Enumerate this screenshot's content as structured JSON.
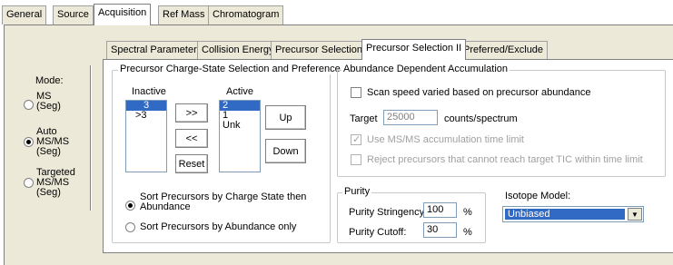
{
  "top_tabs": [
    {
      "label": "General"
    },
    {
      "label": "Source"
    },
    {
      "label": "Acquisition"
    },
    {
      "label": "Ref Mass"
    },
    {
      "label": "Chromatogram"
    }
  ],
  "mode": {
    "label": "Mode:",
    "options": [
      {
        "label": "MS\n(Seg)",
        "checked": false
      },
      {
        "label": "Auto\nMS/MS\n(Seg)",
        "checked": true
      },
      {
        "label": "Targeted\nMS/MS\n(Seg)",
        "checked": false
      }
    ]
  },
  "sub_tabs": [
    {
      "label": "Spectral Parameters"
    },
    {
      "label": "Collision Energy"
    },
    {
      "label": "Precursor Selection I"
    },
    {
      "label": "Precursor Selection II"
    },
    {
      "label": "Preferred/Exclude"
    }
  ],
  "charge_state": {
    "title": "Precursor Charge-State Selection and Preference",
    "inactive_label": "Inactive",
    "active_label": "Active",
    "inactive_items": [
      "3",
      ">3"
    ],
    "active_items": [
      "2",
      "1",
      "Unk"
    ],
    "add_label": ">>",
    "remove_label": "<<",
    "reset_label": "Reset",
    "up_label": "Up",
    "down_label": "Down",
    "sort_by_charge_label": "Sort Precursors by Charge State then\nAbundance",
    "sort_by_abundance_label": "Sort Precursors by Abundance only"
  },
  "abundance": {
    "title": "Abundance Dependent Accumulation",
    "scan_speed_label": "Scan speed varied based on precursor abundance",
    "target_label": "Target",
    "target_value": "25000",
    "target_unit": "counts/spectrum",
    "use_limit_label": "Use MS/MS accumulation time limit",
    "reject_label": "Reject precursors that cannot reach target TIC within time limit"
  },
  "purity": {
    "title": "Purity",
    "stringency_label": "Purity Stringency:",
    "stringency_value": "100",
    "cutoff_label": "Purity Cutoff:",
    "cutoff_value": "30",
    "percent": "%"
  },
  "isotope": {
    "label": "Isotope Model:",
    "value": "Unbiased"
  }
}
